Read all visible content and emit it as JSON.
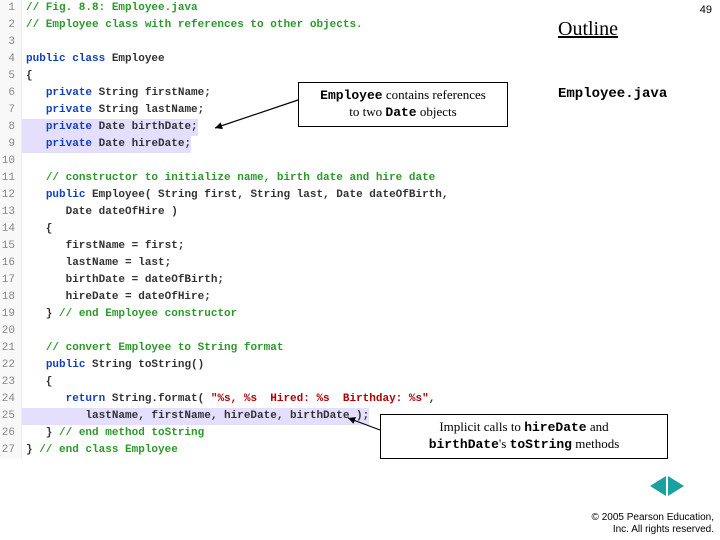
{
  "page_number": "49",
  "outline_label": "Outline",
  "filename": "Employee.java",
  "callout1": {
    "p1_a": "Employee",
    "p1_b": " contains references",
    "p2_a": "to two ",
    "p2_b": "Date",
    "p2_c": " objects"
  },
  "callout2": {
    "p1_a": "Implicit calls to ",
    "p1_b": "hireDate",
    "p1_c": " and",
    "p2_a": "birthDate",
    "p2_b": "'s ",
    "p2_c": "toString",
    "p2_d": " methods"
  },
  "nav": {
    "prev": "◀",
    "next": "▶"
  },
  "copyright": {
    "l1": "© 2005 Pearson Education,",
    "l2": "Inc. All rights reserved."
  },
  "code": [
    {
      "n": "1",
      "seg": [
        {
          "c": "c-comment",
          "t": "// Fig. 8.8: Employee.java"
        }
      ]
    },
    {
      "n": "2",
      "seg": [
        {
          "c": "c-comment",
          "t": "// Employee class with references to other objects."
        }
      ]
    },
    {
      "n": "3",
      "seg": []
    },
    {
      "n": "4",
      "seg": [
        {
          "c": "c-kw",
          "t": "public class"
        },
        {
          "c": "c-plain",
          "t": " Employee"
        }
      ]
    },
    {
      "n": "5",
      "seg": [
        {
          "c": "c-plain",
          "t": "{"
        }
      ]
    },
    {
      "n": "6",
      "seg": [
        {
          "c": "c-plain",
          "t": "   "
        },
        {
          "c": "c-kw",
          "t": "private"
        },
        {
          "c": "c-plain",
          "t": " String firstName;"
        }
      ]
    },
    {
      "n": "7",
      "seg": [
        {
          "c": "c-plain",
          "t": "   "
        },
        {
          "c": "c-kw",
          "t": "private"
        },
        {
          "c": "c-plain",
          "t": " String lastName;"
        }
      ]
    },
    {
      "n": "8",
      "hl": true,
      "seg": [
        {
          "c": "c-plain",
          "t": "   "
        },
        {
          "c": "c-kw",
          "t": "private"
        },
        {
          "c": "c-plain",
          "t": " Date birthDate;"
        }
      ]
    },
    {
      "n": "9",
      "hl": true,
      "seg": [
        {
          "c": "c-plain",
          "t": "   "
        },
        {
          "c": "c-kw",
          "t": "private"
        },
        {
          "c": "c-plain",
          "t": " Date hireDate;"
        }
      ]
    },
    {
      "n": "10",
      "seg": []
    },
    {
      "n": "11",
      "seg": [
        {
          "c": "c-plain",
          "t": "   "
        },
        {
          "c": "c-comment",
          "t": "// constructor to initialize name, birth date and hire date"
        }
      ]
    },
    {
      "n": "12",
      "seg": [
        {
          "c": "c-plain",
          "t": "   "
        },
        {
          "c": "c-kw",
          "t": "public"
        },
        {
          "c": "c-plain",
          "t": " Employee( String first, String last, Date dateOfBirth,"
        }
      ]
    },
    {
      "n": "13",
      "seg": [
        {
          "c": "c-plain",
          "t": "      Date dateOfHire )"
        }
      ]
    },
    {
      "n": "14",
      "seg": [
        {
          "c": "c-plain",
          "t": "   {"
        }
      ]
    },
    {
      "n": "15",
      "seg": [
        {
          "c": "c-plain",
          "t": "      firstName = first;"
        }
      ]
    },
    {
      "n": "16",
      "seg": [
        {
          "c": "c-plain",
          "t": "      lastName = last;"
        }
      ]
    },
    {
      "n": "17",
      "seg": [
        {
          "c": "c-plain",
          "t": "      birthDate = dateOfBirth;"
        }
      ]
    },
    {
      "n": "18",
      "seg": [
        {
          "c": "c-plain",
          "t": "      hireDate = dateOfHire;"
        }
      ]
    },
    {
      "n": "19",
      "seg": [
        {
          "c": "c-plain",
          "t": "   } "
        },
        {
          "c": "c-comment",
          "t": "// end Employee constructor"
        }
      ]
    },
    {
      "n": "20",
      "seg": []
    },
    {
      "n": "21",
      "seg": [
        {
          "c": "c-plain",
          "t": "   "
        },
        {
          "c": "c-comment",
          "t": "// convert Employee to String format"
        }
      ]
    },
    {
      "n": "22",
      "seg": [
        {
          "c": "c-plain",
          "t": "   "
        },
        {
          "c": "c-kw",
          "t": "public"
        },
        {
          "c": "c-plain",
          "t": " String toString()"
        }
      ]
    },
    {
      "n": "23",
      "seg": [
        {
          "c": "c-plain",
          "t": "   {"
        }
      ]
    },
    {
      "n": "24",
      "seg": [
        {
          "c": "c-plain",
          "t": "      "
        },
        {
          "c": "c-kw",
          "t": "return"
        },
        {
          "c": "c-plain",
          "t": " String.format( "
        },
        {
          "c": "c-str",
          "t": "\"%s, %s  Hired: %s  Birthday: %s\""
        },
        {
          "c": "c-plain",
          "t": ","
        }
      ]
    },
    {
      "n": "25",
      "hl": true,
      "seg": [
        {
          "c": "c-plain",
          "t": "         lastName, firstName, hireDate, birthDate"
        },
        {
          "c": "c-plain",
          "t": " );"
        }
      ]
    },
    {
      "n": "26",
      "seg": [
        {
          "c": "c-plain",
          "t": "   } "
        },
        {
          "c": "c-comment",
          "t": "// end method toString"
        }
      ]
    },
    {
      "n": "27",
      "seg": [
        {
          "c": "c-plain",
          "t": "} "
        },
        {
          "c": "c-comment",
          "t": "// end class Employee"
        }
      ]
    }
  ]
}
